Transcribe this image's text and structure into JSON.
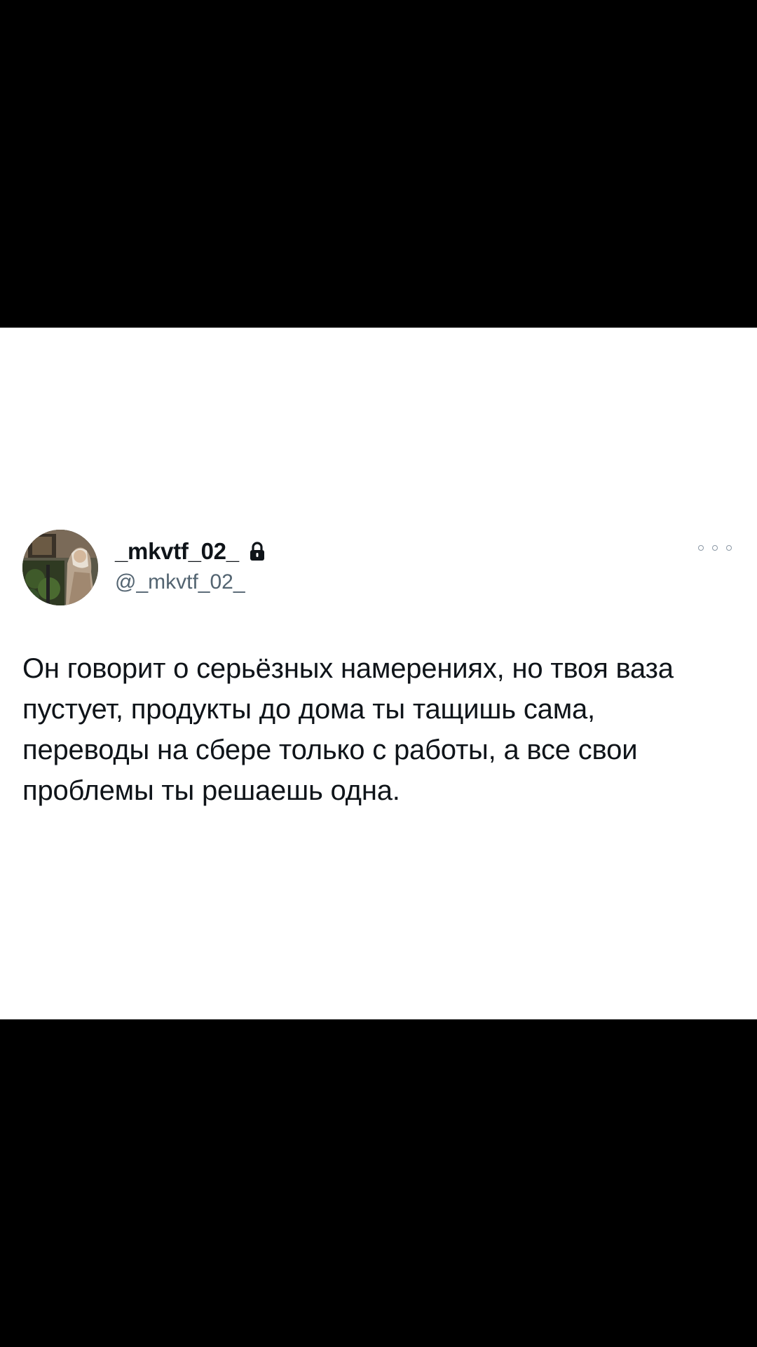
{
  "tweet": {
    "display_name": "_mkvtf_02_",
    "handle": "@_mkvtf_02_",
    "protected_icon": "lock-icon",
    "more_icon": "more-icon",
    "text": "Он говорит о серьёзных намерениях, но твоя ваза\nпустует, продукты до дома ты тащишь сама,\nпереводы на сбере только с работы, а все свои\nпроблемы ты решаешь одна."
  },
  "colors": {
    "background": "#ffffff",
    "letterbox": "#000000",
    "text_primary": "#0f1419",
    "text_secondary": "#536471"
  }
}
